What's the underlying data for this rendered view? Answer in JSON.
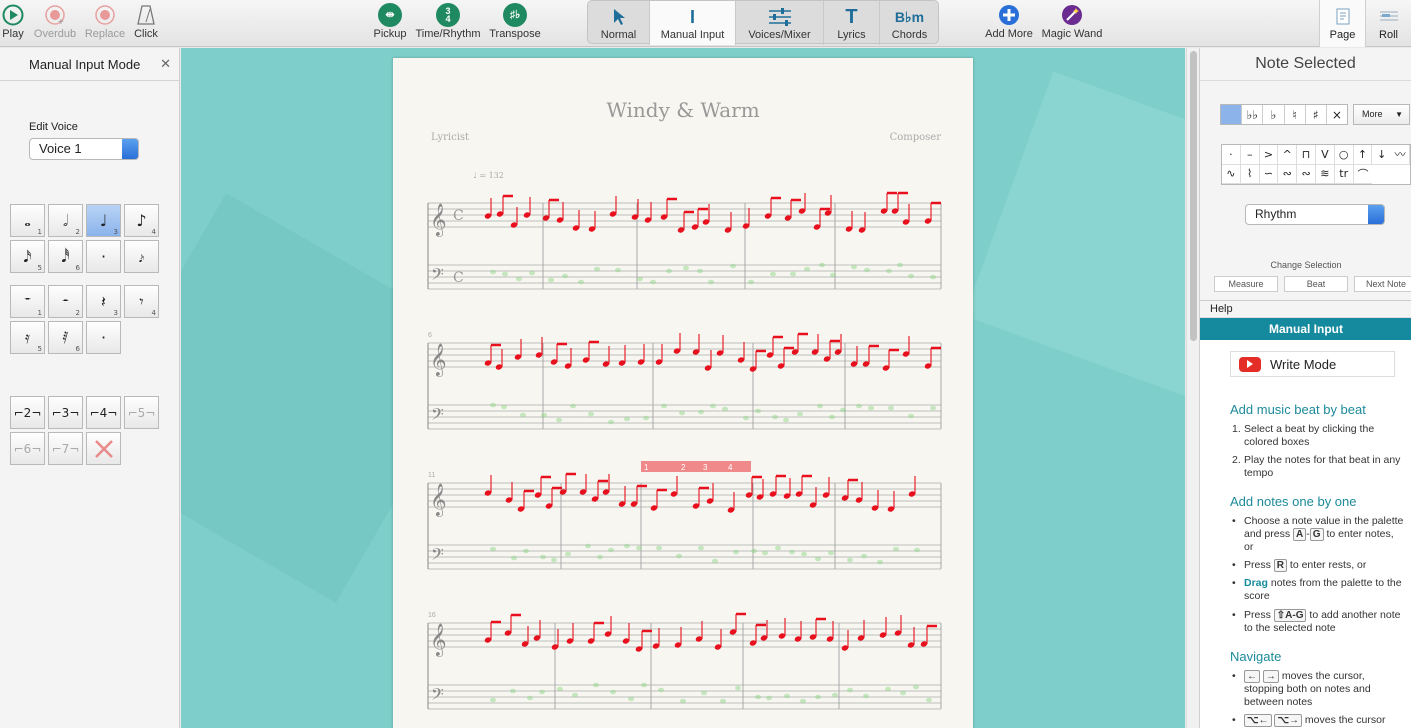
{
  "toolbar": {
    "play": "Play",
    "overdub": "Overdub",
    "replace": "Replace",
    "click": "Click",
    "pickup": "Pickup",
    "time_rhythm": "Time/Rhythm",
    "transpose": "Transpose",
    "modes": [
      {
        "label": "Normal"
      },
      {
        "label": "Manual Input"
      },
      {
        "label": "Voices/Mixer"
      },
      {
        "label": "Lyrics"
      },
      {
        "label": "Chords"
      }
    ],
    "add_more": "Add More",
    "magic_wand": "Magic Wand",
    "page": "Page",
    "roll": "Roll"
  },
  "left_panel": {
    "title": "Manual Input Mode",
    "edit_voice_label": "Edit Voice",
    "voice_value": "Voice 1",
    "note_numbers": [
      "1",
      "2",
      "3",
      "4",
      "5",
      "6"
    ],
    "tuplets": [
      "2",
      "3",
      "4",
      "5",
      "6",
      "7"
    ]
  },
  "score": {
    "title": "Windy & Warm",
    "lyricist": "Lyricist",
    "composer": "Composer",
    "tempo": "♩ = 132",
    "time_signature": "C",
    "measure_numbers": [
      "6",
      "11",
      "16"
    ],
    "beat_markers": [
      "1",
      "2",
      "3",
      "4"
    ]
  },
  "right_panel": {
    "title": "Note Selected",
    "accidentals": [
      "♭♭",
      "♭",
      "♮",
      "♯",
      "×"
    ],
    "more_label": "More",
    "dropdown_value": "Rhythm",
    "change_selection_label": "Change Selection",
    "change_buttons": [
      "Measure",
      "Beat",
      "Next Note"
    ],
    "help_label": "Help",
    "help_header": "Manual Input",
    "write_mode": "Write Mode",
    "section1_title": "Add music beat by beat",
    "section1_items": [
      "Select a beat by clicking the colored boxes",
      "Play the notes for that beat in any tempo"
    ],
    "section2_title": "Add notes one by one",
    "section2_a1": "Choose a note value in the palette and press",
    "section2_a_key1": "A",
    "section2_a_key2": "G",
    "section2_a2": "to enter notes, or",
    "section2_b1": "Press",
    "section2_b_key": "R",
    "section2_b2": "to enter rests, or",
    "section2_c_drag": "Drag",
    "section2_c2": "notes from the palette to the score",
    "section2_d1": "Press",
    "section2_d_key": "⇧A-G",
    "section2_d2": "to add another note to the selected note",
    "section3_title": "Navigate",
    "nav_keys": [
      "←",
      "→"
    ],
    "nav_text": "moves the cursor, stopping both on notes and between notes",
    "nav_keys2": [
      "⌥←",
      "⌥→"
    ],
    "nav_text2": "moves the cursor"
  },
  "colors": {
    "accent": "#158a9e",
    "note_red": "#e8101d",
    "canvas": "#7ecfcb",
    "voice2": "#8fd88a"
  }
}
